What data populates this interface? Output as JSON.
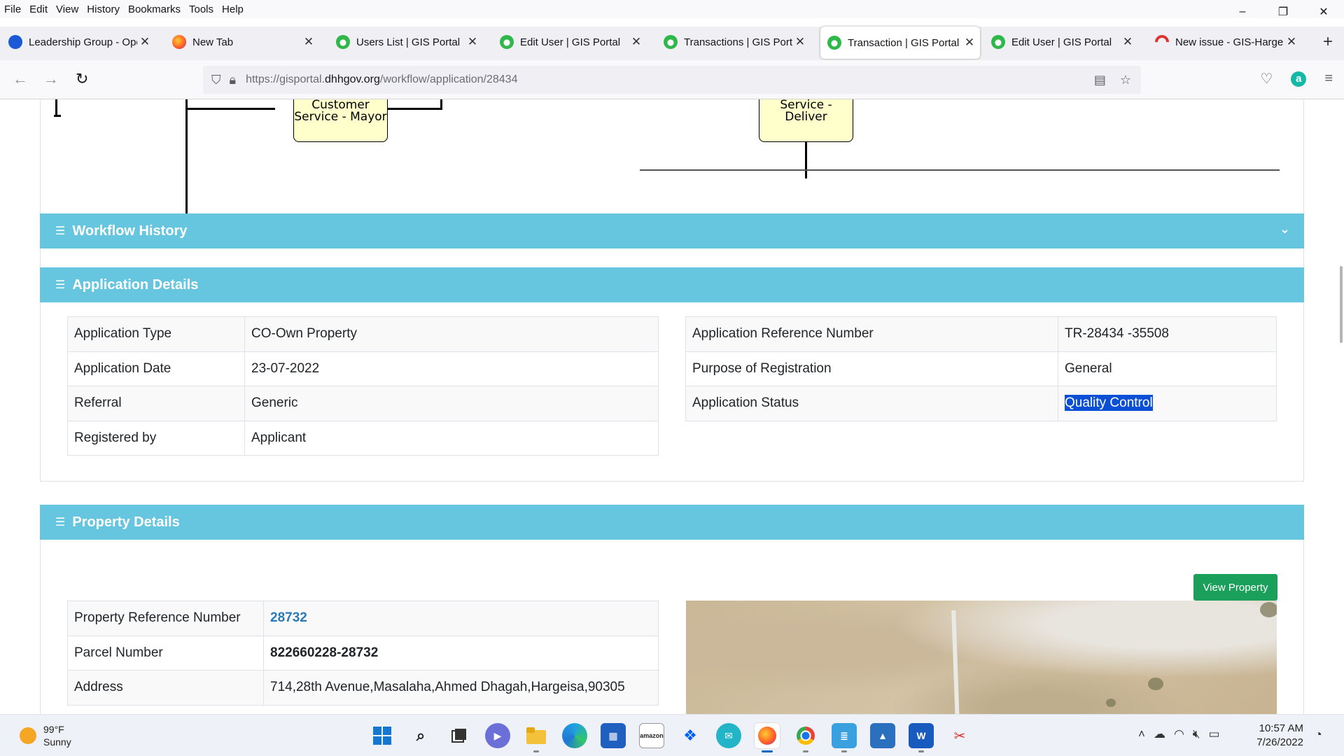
{
  "menubar": [
    "File",
    "Edit",
    "View",
    "History",
    "Bookmarks",
    "Tools",
    "Help"
  ],
  "window_controls": {
    "minimize": "–",
    "maximize": "❐",
    "close": "✕"
  },
  "tabs": [
    {
      "title": "Leadership Group - Oper",
      "favicon": "leadership-icon",
      "active": false
    },
    {
      "title": "New Tab",
      "favicon": "firefox-icon",
      "active": false
    },
    {
      "title": "Users List | GIS Portal",
      "favicon": "gis-icon",
      "active": false
    },
    {
      "title": "Edit User | GIS Portal",
      "favicon": "gis-icon",
      "active": false
    },
    {
      "title": "Transactions | GIS Portal",
      "favicon": "gis-icon",
      "active": false
    },
    {
      "title": "Transaction | GIS Portal",
      "favicon": "gis-icon",
      "active": true
    },
    {
      "title": "Edit User | GIS Portal",
      "favicon": "gis-icon",
      "active": false
    },
    {
      "title": "New issue - GIS-Hargesi",
      "favicon": "github-icon",
      "active": false
    }
  ],
  "tab_close": "✕",
  "new_tab": "+",
  "address": {
    "prefix": "https://gisportal.",
    "domain": "dhhgov.org",
    "path": "/workflow/application/28434"
  },
  "diagram": {
    "node_left": "Customer Service - Mayor",
    "node_right": "Customer Service - Deliver"
  },
  "panels": {
    "workflow_history": "Workflow History",
    "application_details": "Application Details",
    "property_details": "Property Details"
  },
  "application_details": {
    "left": [
      {
        "label": "Application Type",
        "value": "CO-Own Property"
      },
      {
        "label": "Application Date",
        "value": "23-07-2022"
      },
      {
        "label": "Referral",
        "value": "Generic"
      },
      {
        "label": "Registered by",
        "value": "Applicant"
      }
    ],
    "right": [
      {
        "label": "Application Reference Number",
        "value": "TR-28434 -35508"
      },
      {
        "label": "Purpose of Registration",
        "value": "General"
      },
      {
        "label": "Application Status",
        "value": "Quality Control"
      }
    ]
  },
  "property_details": {
    "view_button": "View Property",
    "rows": [
      {
        "label": "Property Reference Number",
        "value": "28732"
      },
      {
        "label": "Parcel Number",
        "value": "822660228-28732"
      },
      {
        "label": "Address",
        "value": "714,28th Avenue,Masalaha,Ahmed Dhagah,Hargeisa,90305"
      }
    ]
  },
  "taskbar": {
    "weather_temp": "99°F",
    "weather_desc": "Sunny",
    "time": "10:57 AM",
    "date": "7/26/2022",
    "apps": [
      "start-icon",
      "search-icon",
      "task-view-icon",
      "chat-icon",
      "file-explorer-icon",
      "edge-icon",
      "store-icon",
      "amazon-icon",
      "dropbox-icon",
      "messenger-icon",
      "firefox-icon",
      "chrome-icon",
      "notepad-icon",
      "photos-icon",
      "word-icon",
      "snipping-tool-icon"
    ]
  },
  "colors": {
    "panel_header": "#66c5df",
    "view_button": "#1aa05a",
    "link": "#2a7ab8",
    "selection": "#0a4fd6"
  }
}
